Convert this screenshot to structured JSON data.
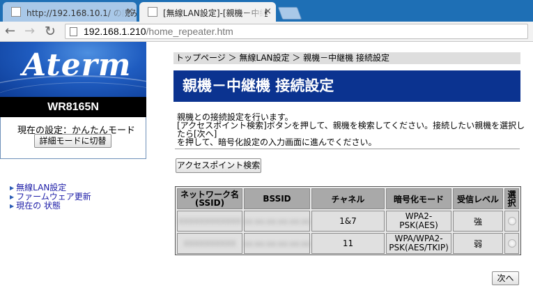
{
  "browser": {
    "tabs": [
      {
        "title": "http://192.168.10.1/ の読み",
        "active": false
      },
      {
        "title": "[無線LAN設定]-[親機－中継",
        "active": true
      }
    ],
    "url_host": "192.168.1.210",
    "url_path": "/home_repeater.htm"
  },
  "sidebar": {
    "logo": "Aterm",
    "model": "WR8165N",
    "mode_text": "現在の設定：かんたんモード",
    "mode_button": "詳細モードに切替",
    "nav": [
      {
        "label": "無線LAN設定"
      },
      {
        "label": "ファームウェア更新"
      },
      {
        "label": "現在の 状態"
      }
    ]
  },
  "main": {
    "breadcrumb": "トップページ ＞ 無線LAN設定 ＞ 親機－中継機 接続設定",
    "title": "親機－中継機 接続設定",
    "desc_lines": [
      "親機との接続設定を行います。",
      "[アクセスポイント検索]ボタンを押して、親機を検索してください。接続したい親機を選択したら[次へ]",
      "を押して、暗号化設定の入力画面に進んでください。"
    ],
    "search_button": "アクセスポイント検索",
    "table": {
      "headers": {
        "ssid_line1": "ネットワーク名",
        "ssid_line2": "(SSID)",
        "bssid": "BSSID",
        "channel": "チャネル",
        "encryption": "暗号化モード",
        "signal": "受信レベル",
        "select_line1": "選",
        "select_line2": "択"
      },
      "rows": [
        {
          "ssid": "XXXXXXXXXXXX",
          "bssid": "xx:xx:xx:xx:xx:xx",
          "channel": "1&7",
          "enc_line1": "WPA2-",
          "enc_line2": "PSK(AES)",
          "signal": "強"
        },
        {
          "ssid": "XXXXXXXXXX",
          "bssid": "xx:xx:xx:xx:xx:xx",
          "channel": "11",
          "enc_line1": "WPA/WPA2-",
          "enc_line2": "PSK(AES/TKIP)",
          "signal": "弱"
        }
      ]
    },
    "next_button": "次へ"
  }
}
